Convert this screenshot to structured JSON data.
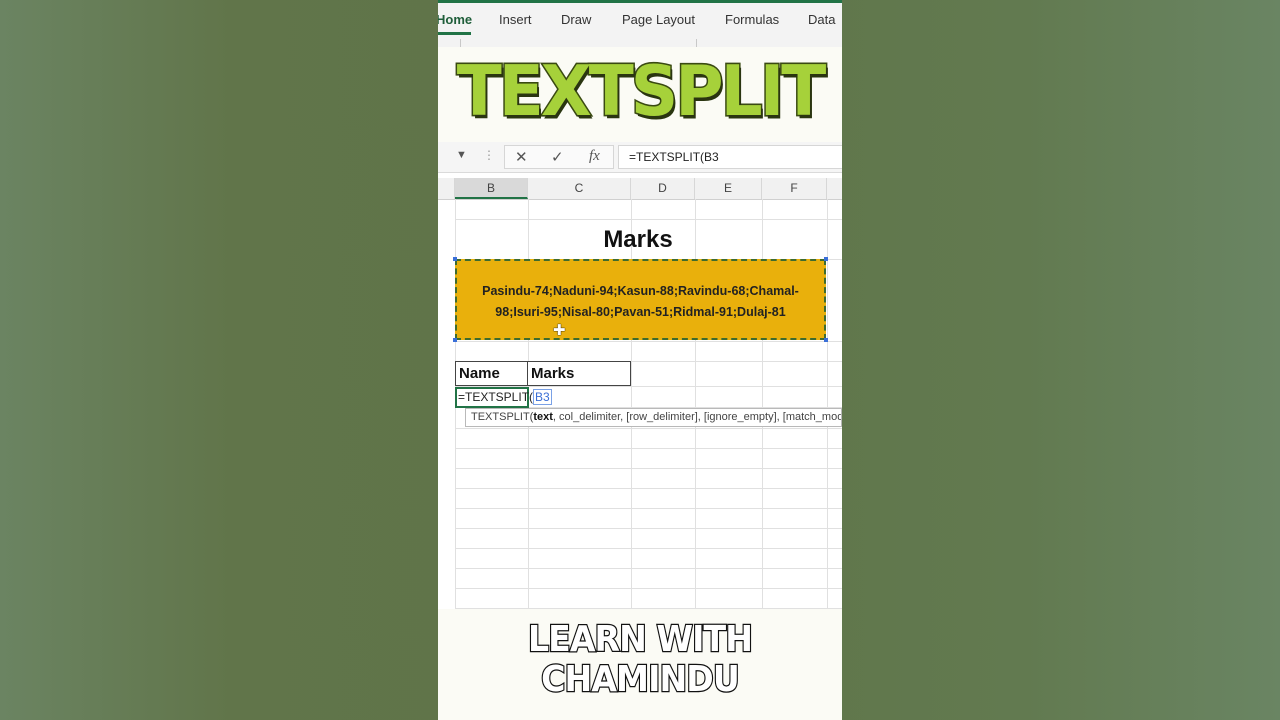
{
  "ribbon": {
    "tabs": [
      "Home",
      "Insert",
      "Draw",
      "Page Layout",
      "Formulas",
      "Data"
    ],
    "active_tab": "Home"
  },
  "banner": {
    "title": "TEXTSPLIT"
  },
  "formula_bar": {
    "cancel_icon": "✕",
    "enter_icon": "✓",
    "fx_label": "fx",
    "formula": "=TEXTSPLIT(B3"
  },
  "columns": [
    "B",
    "C",
    "D",
    "E",
    "F"
  ],
  "sheet": {
    "heading": "Marks",
    "data_cell_line1": "Pasindu-74;Naduni-94;Kasun-88;Ravindu-68;Chamal-",
    "data_cell_line2": "98;Isuri-95;Nisal-80;Pavan-51;Ridmal-91;Dulaj-81",
    "header_name": "Name",
    "header_marks": "Marks",
    "active_cell_prefix": "=TEXTSPLIT(",
    "active_cell_ref": "B3"
  },
  "tooltip": {
    "fn": "TEXTSPLIT(",
    "arg_current": "text",
    "rest": ", col_delimiter, [row_delimiter], [ignore_empty], [match_mode], [pad_with])"
  },
  "caption": {
    "line1": "LEARN WITH",
    "line2": "CHAMINDU"
  },
  "colors": {
    "excel_green": "#217346",
    "cell_fill": "#e9b00c",
    "title_green": "#a6d13a"
  }
}
